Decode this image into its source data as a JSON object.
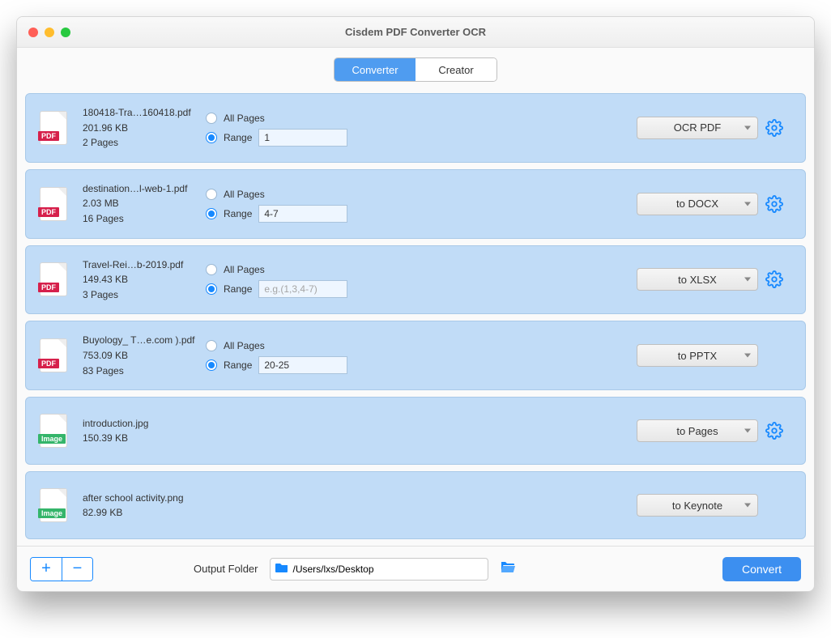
{
  "window": {
    "title": "Cisdem PDF Converter OCR"
  },
  "tabs": {
    "converter": "Converter",
    "creator": "Creator",
    "active": "converter"
  },
  "labels": {
    "all_pages": "All Pages",
    "range": "Range",
    "range_placeholder": "e.g.(1,3,4-7)",
    "output_folder": "Output Folder",
    "convert": "Convert"
  },
  "footer": {
    "path": "/Users/lxs/Desktop"
  },
  "files": [
    {
      "type": "pdf",
      "name": "180418-Tra…160418.pdf",
      "size": "201.96 KB",
      "pages": "2 Pages",
      "has_pages": true,
      "range_selected": true,
      "range_value": "1",
      "format": "OCR PDF",
      "has_gear": true
    },
    {
      "type": "pdf",
      "name": "destination…l-web-1.pdf",
      "size": "2.03 MB",
      "pages": "16 Pages",
      "has_pages": true,
      "range_selected": true,
      "range_value": "4-7",
      "format": "to DOCX",
      "has_gear": true
    },
    {
      "type": "pdf",
      "name": "Travel-Rei…b-2019.pdf",
      "size": "149.43 KB",
      "pages": "3 Pages",
      "has_pages": true,
      "range_selected": true,
      "range_value": "",
      "format": "to XLSX",
      "has_gear": true
    },
    {
      "type": "pdf",
      "name": "Buyology_ T…e.com ).pdf",
      "size": "753.09 KB",
      "pages": "83 Pages",
      "has_pages": true,
      "range_selected": true,
      "range_value": "20-25",
      "format": "to PPTX",
      "has_gear": false
    },
    {
      "type": "image",
      "name": "introduction.jpg",
      "size": "150.39 KB",
      "pages": "",
      "has_pages": false,
      "range_selected": false,
      "range_value": "",
      "format": "to Pages",
      "has_gear": true
    },
    {
      "type": "image",
      "name": "after school activity.png",
      "size": "82.99 KB",
      "pages": "",
      "has_pages": false,
      "range_selected": false,
      "range_value": "",
      "format": "to Keynote",
      "has_gear": false
    }
  ]
}
